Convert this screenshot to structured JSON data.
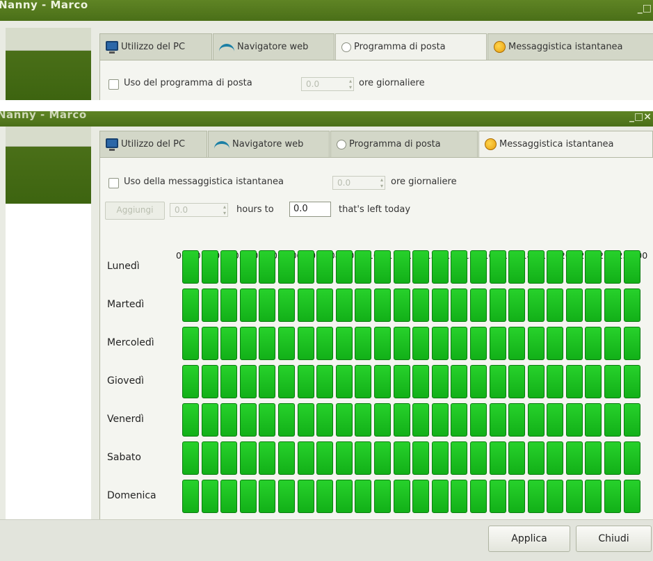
{
  "window": {
    "title_top": "Nanny - Marco",
    "title_bottom": "Nanny - Marco",
    "controls_top": "_□",
    "controls_bottom": "_□×"
  },
  "tabs": [
    {
      "label": "Utilizzo del PC",
      "icon": "monitor-icon"
    },
    {
      "label": "Navigatore web",
      "icon": "web-icon"
    },
    {
      "label": "Programma di posta",
      "icon": "mail-icon"
    },
    {
      "label": "Messaggistica istantanea",
      "icon": "smile-icon"
    }
  ],
  "mail_tab": {
    "checkbox_label": "Uso del programma di posta",
    "spin_value": "0.0",
    "suffix": "ore giornaliere"
  },
  "im_tab": {
    "checkbox_label": "Uso della messaggistica istantanea",
    "spin_value": "0.0",
    "suffix": "ore giornaliere",
    "add_button": "Aggiungi",
    "add_value": "0.0",
    "hours_to": "hours to",
    "left_value": "0.0",
    "left_today": "that's left today"
  },
  "hours": [
    "00",
    "01",
    "02",
    "03",
    "04",
    "05",
    "06",
    "07",
    "08",
    "09",
    "10",
    "11",
    "12",
    "13",
    "14",
    "15",
    "16",
    "17",
    "18",
    "19",
    "20",
    "21",
    "22",
    "23",
    "00"
  ],
  "days": [
    "Lunedì",
    "Martedì",
    "Mercoledì",
    "Giovedì",
    "Venerdì",
    "Sabato",
    "Domenica"
  ],
  "buttons": {
    "apply": "Applica",
    "close": "Chiudi"
  },
  "colors": {
    "titlebar": "#4a6f18",
    "cell_allowed": "#1ec324"
  }
}
